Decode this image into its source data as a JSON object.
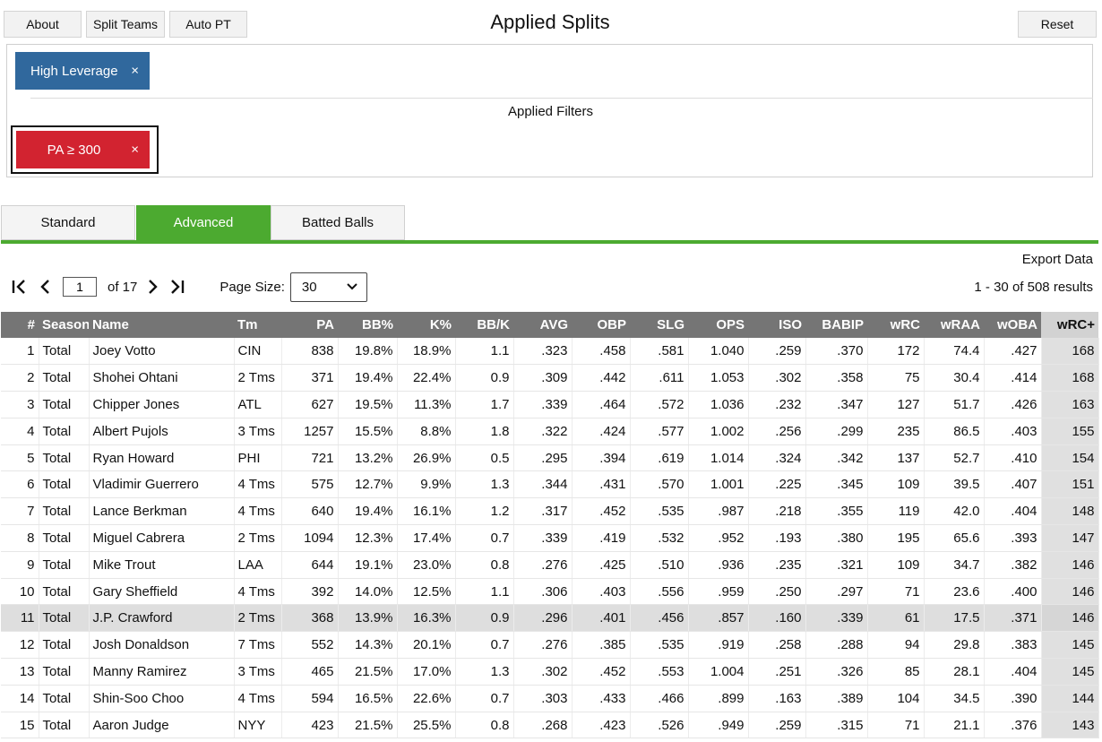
{
  "toolbar": {
    "about": "About",
    "split_teams": "Split Teams",
    "auto_pt": "Auto PT",
    "reset": "Reset"
  },
  "title": "Applied Splits",
  "applied_split": {
    "label": "High Leverage",
    "remove": "×"
  },
  "filters_label": "Applied Filters",
  "applied_filter": {
    "label": "PA ≥ 300",
    "remove": "×"
  },
  "tabs": [
    "Standard",
    "Advanced",
    "Batted Balls"
  ],
  "active_tab": "Advanced",
  "export": "Export Data",
  "pager": {
    "page": "1",
    "of": "of 17",
    "page_size_label": "Page Size:",
    "page_size": "30",
    "results": "1 - 30 of 508 results"
  },
  "colors": {
    "split_blue": "#30689d",
    "filter_red": "#d22330",
    "tab_green": "#4caa30",
    "header_gray": "#757575"
  },
  "table": {
    "columns": [
      "#",
      "Season",
      "Name",
      "Tm",
      "PA",
      "BB%",
      "K%",
      "BB/K",
      "AVG",
      "OBP",
      "SLG",
      "OPS",
      "ISO",
      "BABIP",
      "wRC",
      "wRAA",
      "wOBA",
      "wRC+"
    ],
    "rows": [
      [
        "1",
        "Total",
        "Joey Votto",
        "CIN",
        "838",
        "19.8%",
        "18.9%",
        "1.1",
        ".323",
        ".458",
        ".581",
        "1.040",
        ".259",
        ".370",
        "172",
        "74.4",
        ".427",
        "168"
      ],
      [
        "2",
        "Total",
        "Shohei Ohtani",
        "2 Tms",
        "371",
        "19.4%",
        "22.4%",
        "0.9",
        ".309",
        ".442",
        ".611",
        "1.053",
        ".302",
        ".358",
        "75",
        "30.4",
        ".414",
        "168"
      ],
      [
        "3",
        "Total",
        "Chipper Jones",
        "ATL",
        "627",
        "19.5%",
        "11.3%",
        "1.7",
        ".339",
        ".464",
        ".572",
        "1.036",
        ".232",
        ".347",
        "127",
        "51.7",
        ".426",
        "163"
      ],
      [
        "4",
        "Total",
        "Albert Pujols",
        "3 Tms",
        "1257",
        "15.5%",
        "8.8%",
        "1.8",
        ".322",
        ".424",
        ".577",
        "1.002",
        ".256",
        ".299",
        "235",
        "86.5",
        ".403",
        "155"
      ],
      [
        "5",
        "Total",
        "Ryan Howard",
        "PHI",
        "721",
        "13.2%",
        "26.9%",
        "0.5",
        ".295",
        ".394",
        ".619",
        "1.014",
        ".324",
        ".342",
        "137",
        "52.7",
        ".410",
        "154"
      ],
      [
        "6",
        "Total",
        "Vladimir Guerrero",
        "4 Tms",
        "575",
        "12.7%",
        "9.9%",
        "1.3",
        ".344",
        ".431",
        ".570",
        "1.001",
        ".225",
        ".345",
        "109",
        "39.5",
        ".407",
        "151"
      ],
      [
        "7",
        "Total",
        "Lance Berkman",
        "4 Tms",
        "640",
        "19.4%",
        "16.1%",
        "1.2",
        ".317",
        ".452",
        ".535",
        ".987",
        ".218",
        ".355",
        "119",
        "42.0",
        ".404",
        "148"
      ],
      [
        "8",
        "Total",
        "Miguel Cabrera",
        "2 Tms",
        "1094",
        "12.3%",
        "17.4%",
        "0.7",
        ".339",
        ".419",
        ".532",
        ".952",
        ".193",
        ".380",
        "195",
        "65.6",
        ".393",
        "147"
      ],
      [
        "9",
        "Total",
        "Mike Trout",
        "LAA",
        "644",
        "19.1%",
        "23.0%",
        "0.8",
        ".276",
        ".425",
        ".510",
        ".936",
        ".235",
        ".321",
        "109",
        "34.7",
        ".382",
        "146"
      ],
      [
        "10",
        "Total",
        "Gary Sheffield",
        "4 Tms",
        "392",
        "14.0%",
        "12.5%",
        "1.1",
        ".306",
        ".403",
        ".556",
        ".959",
        ".250",
        ".297",
        "71",
        "23.6",
        ".400",
        "146"
      ],
      [
        "11",
        "Total",
        "J.P. Crawford",
        "2 Tms",
        "368",
        "13.9%",
        "16.3%",
        "0.9",
        ".296",
        ".401",
        ".456",
        ".857",
        ".160",
        ".339",
        "61",
        "17.5",
        ".371",
        "146"
      ],
      [
        "12",
        "Total",
        "Josh Donaldson",
        "7 Tms",
        "552",
        "14.3%",
        "20.1%",
        "0.7",
        ".276",
        ".385",
        ".535",
        ".919",
        ".258",
        ".288",
        "94",
        "29.8",
        ".383",
        "145"
      ],
      [
        "13",
        "Total",
        "Manny Ramirez",
        "3 Tms",
        "465",
        "21.5%",
        "17.0%",
        "1.3",
        ".302",
        ".452",
        ".553",
        "1.004",
        ".251",
        ".326",
        "85",
        "28.1",
        ".404",
        "145"
      ],
      [
        "14",
        "Total",
        "Shin-Soo Choo",
        "4 Tms",
        "594",
        "16.5%",
        "22.6%",
        "0.7",
        ".303",
        ".433",
        ".466",
        ".899",
        ".163",
        ".389",
        "104",
        "34.5",
        ".390",
        "144"
      ],
      [
        "15",
        "Total",
        "Aaron Judge",
        "NYY",
        "423",
        "21.5%",
        "25.5%",
        "0.8",
        ".268",
        ".423",
        ".526",
        ".949",
        ".259",
        ".315",
        "71",
        "21.1",
        ".376",
        "143"
      ]
    ]
  }
}
